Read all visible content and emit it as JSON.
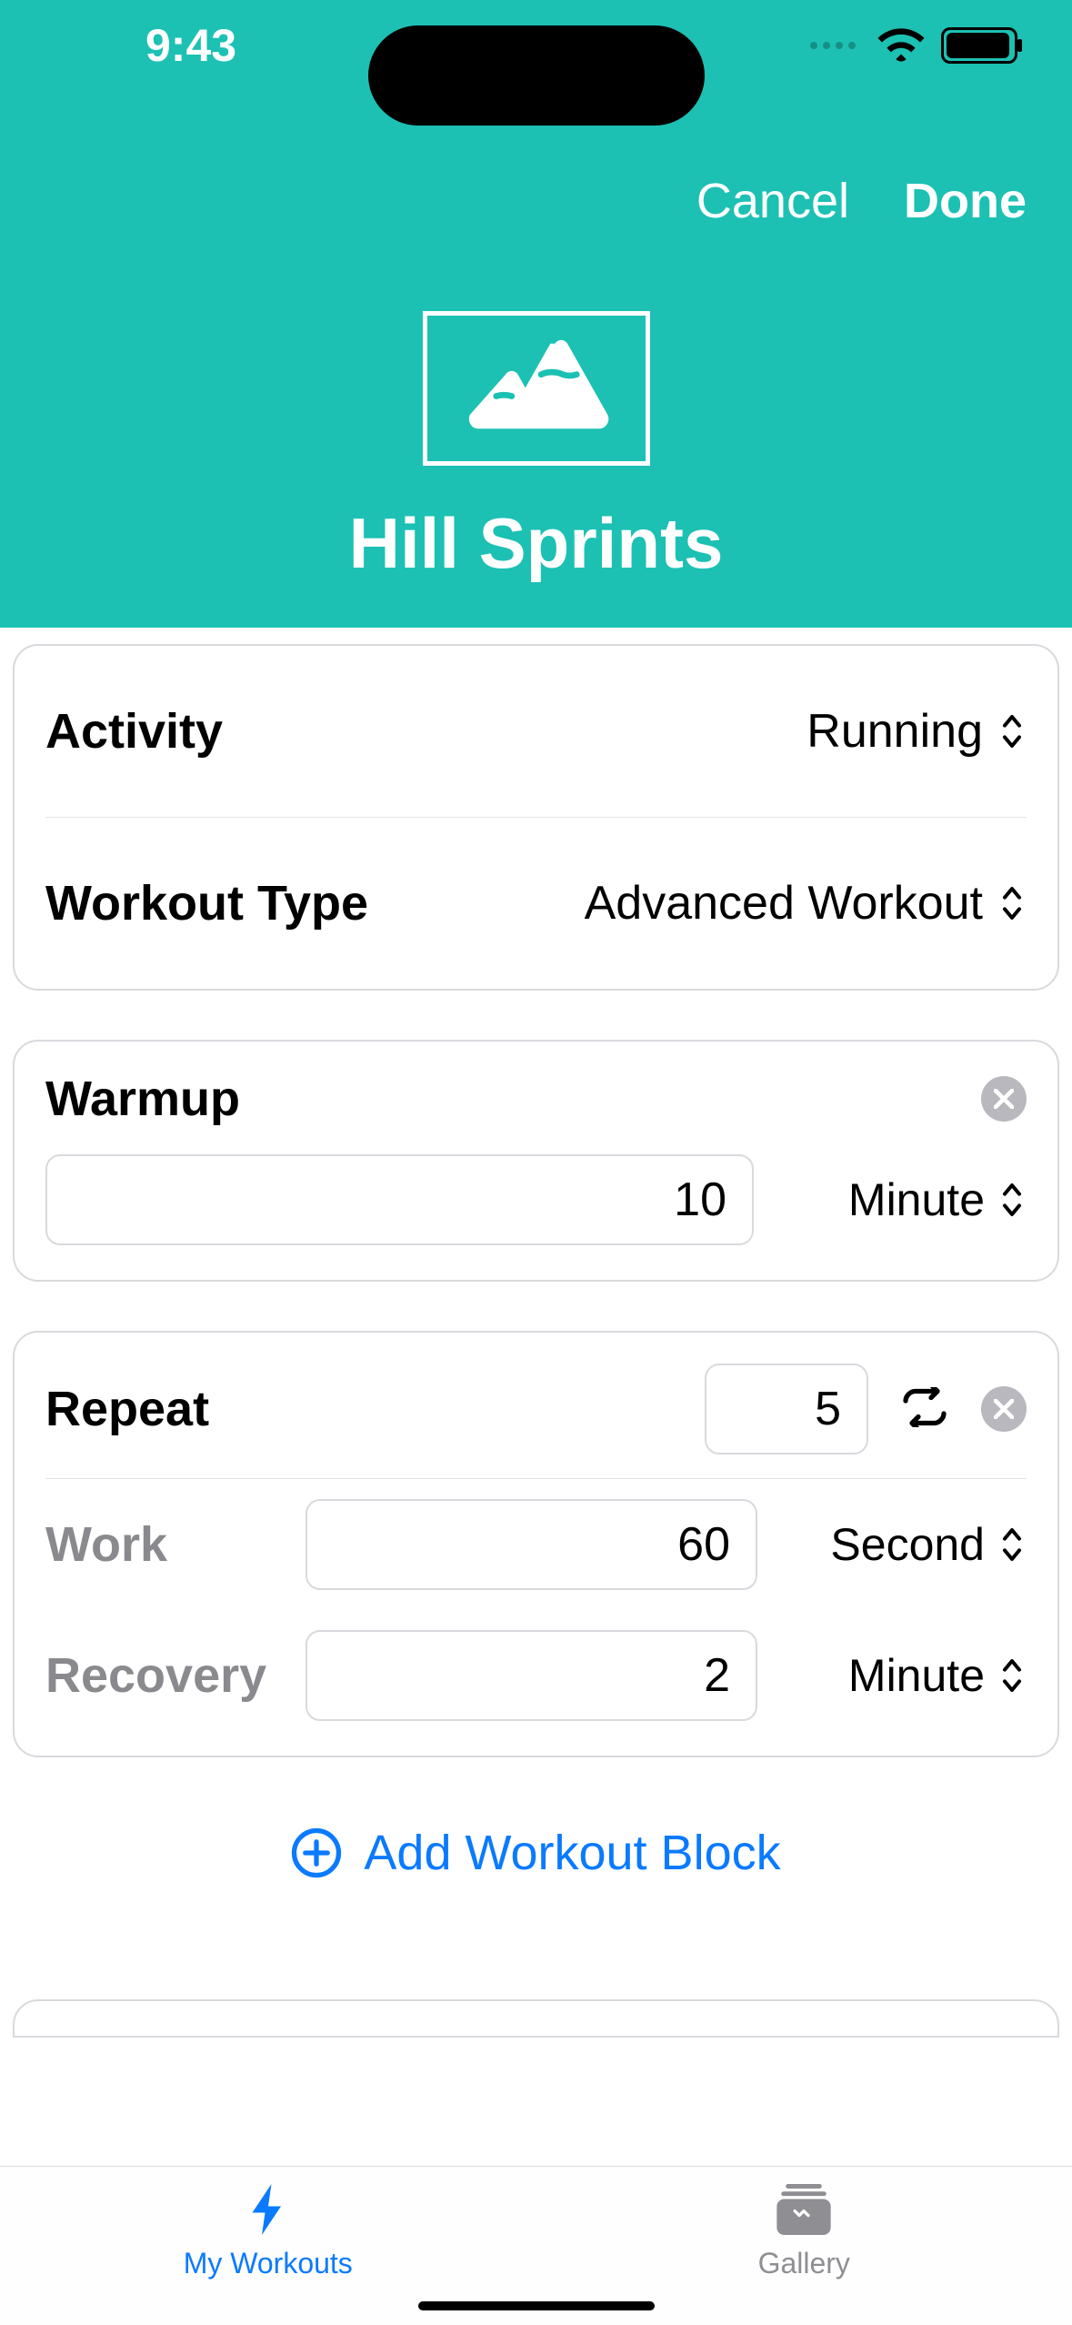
{
  "status": {
    "time": "9:43"
  },
  "nav": {
    "cancel": "Cancel",
    "done": "Done"
  },
  "workout": {
    "title": "Hill Sprints"
  },
  "settings": {
    "activity_label": "Activity",
    "activity_value": "Running",
    "type_label": "Workout Type",
    "type_value": "Advanced Workout"
  },
  "warmup": {
    "title": "Warmup",
    "value": "10",
    "unit": "Minute"
  },
  "repeat": {
    "title": "Repeat",
    "count": "5",
    "work_label": "Work",
    "work_value": "60",
    "work_unit": "Second",
    "recovery_label": "Recovery",
    "recovery_value": "2",
    "recovery_unit": "Minute"
  },
  "add_block": "Add Workout Block",
  "tabs": {
    "my_workouts": "My Workouts",
    "gallery": "Gallery"
  }
}
